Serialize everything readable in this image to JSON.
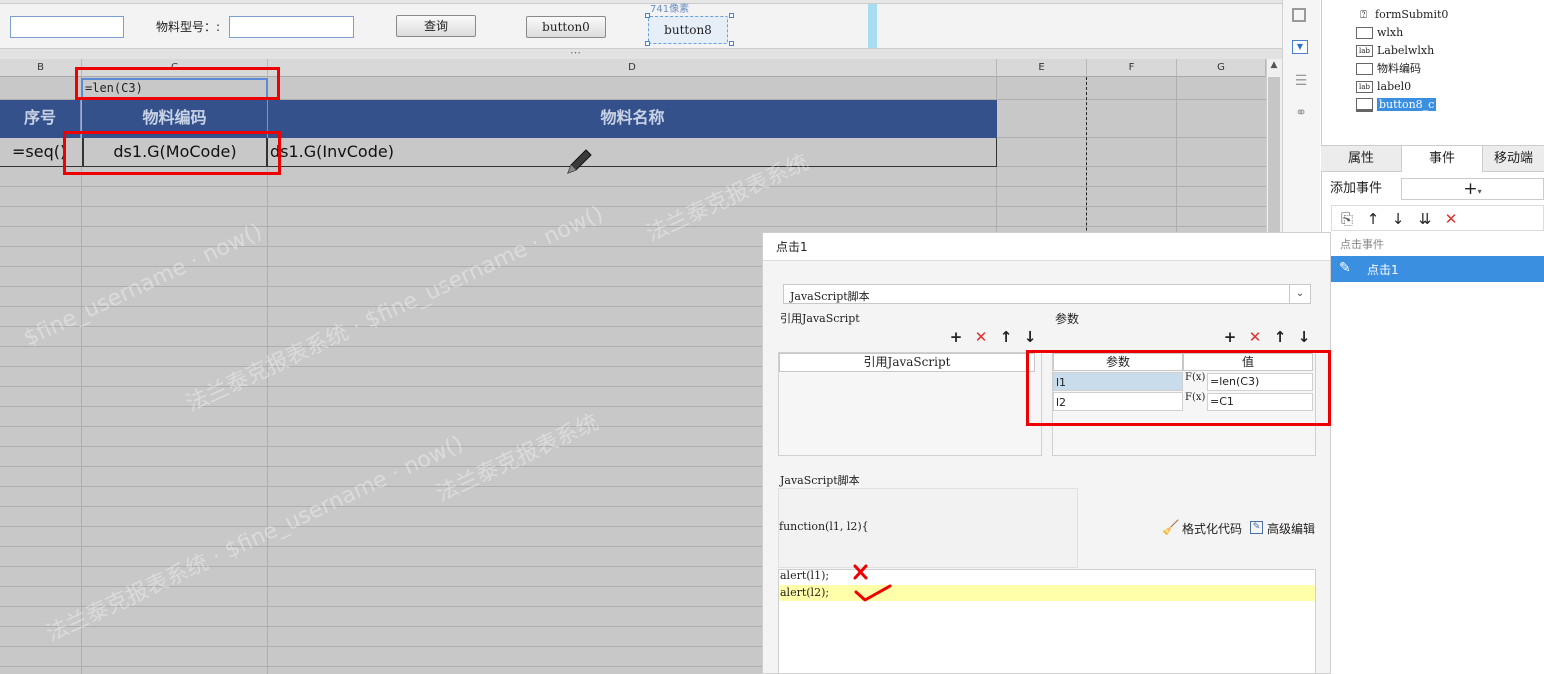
{
  "form": {
    "material_model_label": "物料型号：:",
    "query_button": "查询",
    "button0_label": "button0",
    "button8_label": "button8",
    "size_hint": "741像素",
    "splitter_grip": "⋯"
  },
  "sheet": {
    "columns": [
      "B",
      "C",
      "D",
      "E",
      "F",
      "G"
    ],
    "formula_cell": "=len(C3)",
    "headers": {
      "seq": "序号",
      "code": "物料编码",
      "name": "物料名称"
    },
    "row": {
      "seq": "=seq()",
      "code": "ds1.G(MoCode)",
      "name": "ds1.G(InvCode)"
    },
    "watermarks": [
      "法兰泰克报表系统 · $fine_username · now()",
      "$fine_username · now()",
      "法兰泰克报表系统"
    ]
  },
  "tree": {
    "items": [
      {
        "label": "formSubmit0",
        "icon": "form-submit-icon"
      },
      {
        "label": "wlxh",
        "icon": "textfield-icon"
      },
      {
        "label": "Labelwlxh",
        "icon": "label-icon"
      },
      {
        "label": "物料编码",
        "icon": "textfield-icon"
      },
      {
        "label": "label0",
        "icon": "label-icon"
      },
      {
        "label": "button8_c",
        "icon": "button-icon"
      }
    ]
  },
  "props": {
    "tabs": [
      "属性",
      "事件",
      "移动端"
    ],
    "add_event_label": "添加事件",
    "event_group": "点击事件",
    "event_item": "点击1"
  },
  "dialog": {
    "title": "点击1",
    "type_select": "JavaScript脚本",
    "ref_js_label": "引用JavaScript",
    "params_label": "参数",
    "ref_js_col": "引用JavaScript",
    "params_col_name": "参数",
    "params_col_value": "值",
    "params": [
      {
        "name": "l1",
        "fx": "F(x)",
        "value": "=len(C3)"
      },
      {
        "name": "l2",
        "fx": "F(x)",
        "value": "=C1"
      }
    ],
    "script_label": "JavaScript脚本",
    "function_sig": "function(l1, l2){",
    "format_code": "格式化代码",
    "advanced_edit": "高级编辑",
    "code_lines": [
      "alert(l1);",
      "alert(l2);"
    ]
  }
}
